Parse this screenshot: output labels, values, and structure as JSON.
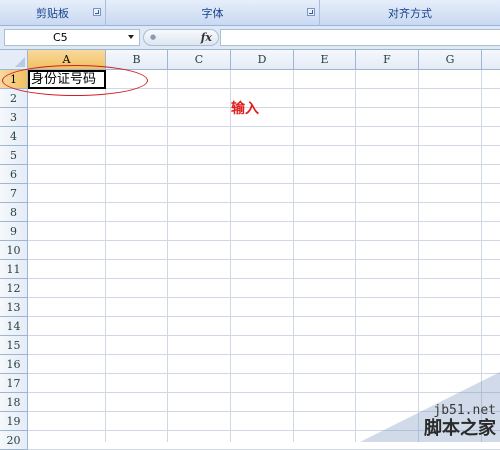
{
  "ribbon": {
    "groups": [
      {
        "label": "剪贴板"
      },
      {
        "label": "字体"
      },
      {
        "label": "对齐方式"
      }
    ]
  },
  "formula_bar": {
    "name_box": "C5",
    "fx_label": "fx",
    "formula_value": ""
  },
  "sheet": {
    "columns": [
      "A",
      "B",
      "C",
      "D",
      "E",
      "F",
      "G"
    ],
    "rows": [
      "1",
      "2",
      "3",
      "4",
      "5",
      "6",
      "7",
      "8",
      "9",
      "10",
      "11",
      "12",
      "13",
      "14",
      "15",
      "16",
      "17",
      "18",
      "19",
      "20"
    ],
    "cell_a1": "身份证号码",
    "annotation": "输入"
  },
  "watermark": {
    "site": "jb51.net",
    "name": "脚本之家"
  },
  "colors": {
    "annotation_red": "#e0201e",
    "ribbon_text": "#15428b",
    "gridline": "#d0d7e5"
  }
}
